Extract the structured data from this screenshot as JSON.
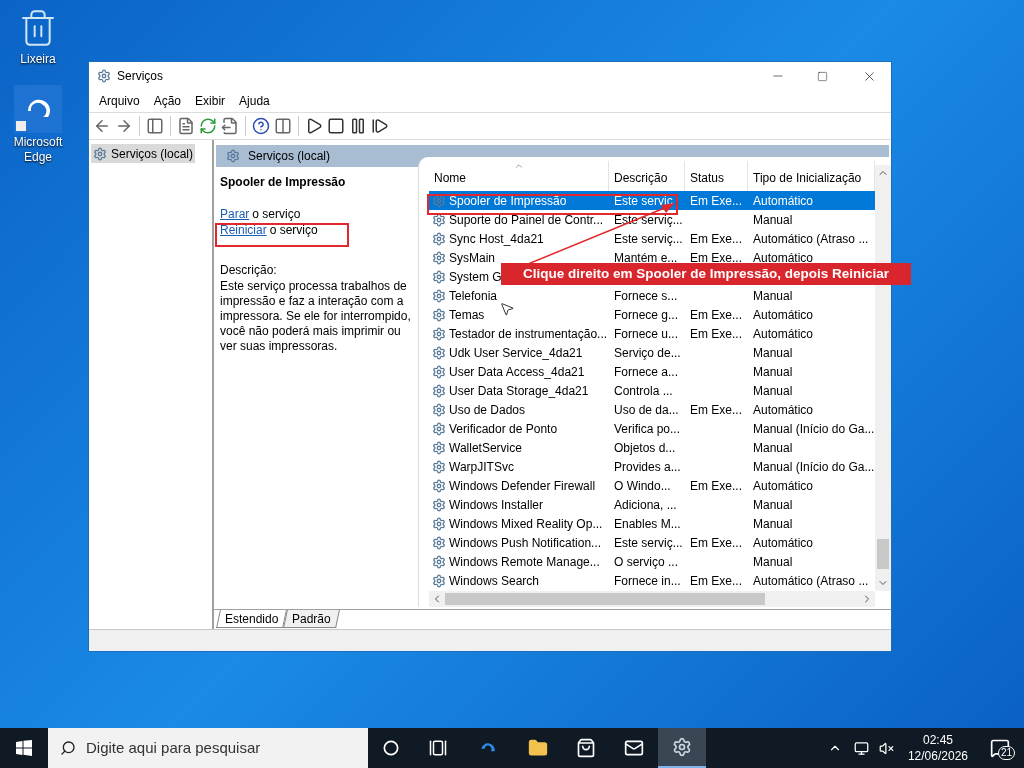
{
  "desktop_icons": [
    {
      "kind": "recycle",
      "label": "Lixeira"
    },
    {
      "kind": "edge",
      "label": "Microsoft Edge"
    }
  ],
  "window": {
    "title": "Serviços",
    "menu": [
      "Arquivo",
      "Ação",
      "Exibir",
      "Ajuda"
    ],
    "tree": [
      {
        "label": "Serviços (local)",
        "selected": true
      }
    ],
    "pane_header": "Serviços (local)",
    "detail": {
      "title": "Spooler de Impressão",
      "actions": [
        {
          "link": "Parar",
          "rest": "o serviço"
        },
        {
          "link": "Reiniciar",
          "rest": "o serviço"
        }
      ],
      "description_label": "Descrição:",
      "description": "Este serviço processa trabalhos de impressão e faz a interação com a impressora. Se ele for interrompido, você não poderá mais imprimir ou ver suas impressoras."
    },
    "table": {
      "columns": [
        {
          "label": "Nome",
          "sorted": true
        },
        {
          "label": "Descrição",
          "sorted": false
        },
        {
          "label": "Status",
          "sorted": false
        },
        {
          "label": "Tipo de Inicialização",
          "sorted": false
        }
      ],
      "rows": [
        {
          "name": "Spooler de Impressão",
          "description": "Este servic",
          "status": "Em Exe...",
          "startup": "Automático",
          "selected": true
        },
        {
          "name": "Suporte do Painel de Contr...",
          "description": "Este serviç...",
          "status": "",
          "startup": "Manual",
          "selected": false
        },
        {
          "name": "Sync Host_4da21",
          "description": "Este serviç...",
          "status": "Em Exe...",
          "startup": "Automático (Atraso ...",
          "selected": false
        },
        {
          "name": "SysMain",
          "description": "Mantém e...",
          "status": "Em Exe...",
          "startup": "Automático",
          "selected": false
        },
        {
          "name": "System G",
          "description": "",
          "status": "",
          "startup": "",
          "selected": false
        },
        {
          "name": "Telefonia",
          "description": "Fornece s...",
          "status": "",
          "startup": "Manual",
          "selected": false
        },
        {
          "name": "Temas",
          "description": "Fornece g...",
          "status": "Em Exe...",
          "startup": "Automático",
          "selected": false
        },
        {
          "name": "Testador de instrumentação...",
          "description": "Fornece u...",
          "status": "Em Exe...",
          "startup": "Automático",
          "selected": false
        },
        {
          "name": "Udk User Service_4da21",
          "description": "Serviço de...",
          "status": "",
          "startup": "Manual",
          "selected": false
        },
        {
          "name": "User Data Access_4da21",
          "description": "Fornece a...",
          "status": "",
          "startup": "Manual",
          "selected": false
        },
        {
          "name": "User Data Storage_4da21",
          "description": "Controla ...",
          "status": "",
          "startup": "Manual",
          "selected": false
        },
        {
          "name": "Uso de Dados",
          "description": "Uso de da...",
          "status": "Em Exe...",
          "startup": "Automático",
          "selected": false
        },
        {
          "name": "Verificador de Ponto",
          "description": "Verifica po...",
          "status": "",
          "startup": "Manual (Início do Ga...",
          "selected": false
        },
        {
          "name": "WalletService",
          "description": "Objetos d...",
          "status": "",
          "startup": "Manual",
          "selected": false
        },
        {
          "name": "WarpJITSvc",
          "description": "Provides a...",
          "status": "",
          "startup": "Manual (Início do Ga...",
          "selected": false
        },
        {
          "name": "Windows Defender Firewall",
          "description": "O Windo...",
          "status": "Em Exe...",
          "startup": "Automático",
          "selected": false
        },
        {
          "name": "Windows Installer",
          "description": "Adiciona, ...",
          "status": "",
          "startup": "Manual",
          "selected": false
        },
        {
          "name": "Windows Mixed Reality Op...",
          "description": "Enables M...",
          "status": "",
          "startup": "Manual",
          "selected": false
        },
        {
          "name": "Windows Push Notification...",
          "description": "Este serviç...",
          "status": "Em Exe...",
          "startup": "Automático",
          "selected": false
        },
        {
          "name": "Windows Remote Manage...",
          "description": "O serviço ...",
          "status": "",
          "startup": "Manual",
          "selected": false
        },
        {
          "name": "Windows Search",
          "description": "Fornece in...",
          "status": "Em Exe...",
          "startup": "Automático (Atraso ...",
          "selected": false
        }
      ]
    },
    "tabs": [
      {
        "label": "Estendido",
        "selected": true
      },
      {
        "label": "Padrão",
        "selected": false
      }
    ]
  },
  "annotation": {
    "text": "Clique direito em Spooler de Impressão, depois Reiniciar"
  },
  "taskbar": {
    "search_placeholder": "Digite aqui para pesquisar",
    "time": "02:45",
    "date": "12/06/2026",
    "notification_count": "21"
  }
}
